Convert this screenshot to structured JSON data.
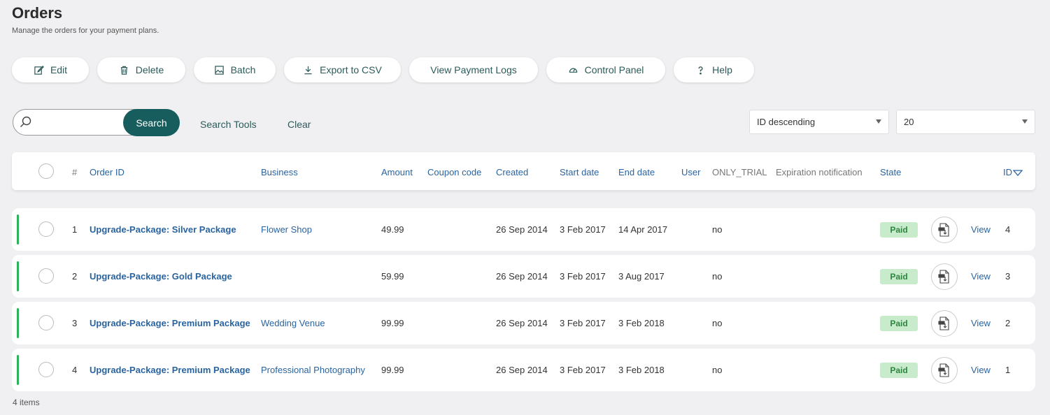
{
  "page": {
    "title": "Orders",
    "subtitle": "Manage the orders for your payment plans."
  },
  "toolbar": {
    "edit": "Edit",
    "delete": "Delete",
    "batch": "Batch",
    "export": "Export to CSV",
    "logs": "View Payment Logs",
    "control": "Control Panel",
    "help": "Help"
  },
  "search": {
    "placeholder": "",
    "button": "Search",
    "tools": "Search Tools",
    "clear": "Clear"
  },
  "sort": {
    "selected": "ID descending",
    "per_page": "20"
  },
  "table": {
    "headers": {
      "num": "#",
      "order_id": "Order ID",
      "business": "Business",
      "amount": "Amount",
      "coupon": "Coupon code",
      "created": "Created",
      "start": "Start date",
      "end": "End date",
      "user": "User",
      "trial": "ONLY_TRIAL",
      "expiration": "Expiration notification",
      "state": "State",
      "id": "ID"
    },
    "rows": [
      {
        "num": "1",
        "order_id": "Upgrade-Package: Silver Package",
        "business": "Flower Shop",
        "amount": "49.99",
        "coupon": "",
        "created": "26 Sep 2014",
        "start": "3 Feb 2017",
        "end": "14 Apr 2017",
        "user": "",
        "trial": "no",
        "state": "Paid",
        "view": "View",
        "id": "4"
      },
      {
        "num": "2",
        "order_id": "Upgrade-Package: Gold Package",
        "business": "",
        "amount": "59.99",
        "coupon": "",
        "created": "26 Sep 2014",
        "start": "3 Feb 2017",
        "end": "3 Aug 2017",
        "user": "",
        "trial": "no",
        "state": "Paid",
        "view": "View",
        "id": "3"
      },
      {
        "num": "3",
        "order_id": "Upgrade-Package: Premium Package",
        "business": "Wedding Venue",
        "amount": "99.99",
        "coupon": "",
        "created": "26 Sep 2014",
        "start": "3 Feb 2017",
        "end": "3 Feb 2018",
        "user": "",
        "trial": "no",
        "state": "Paid",
        "view": "View",
        "id": "2"
      },
      {
        "num": "4",
        "order_id": "Upgrade-Package: Premium Package",
        "business": "Professional Photography",
        "amount": "99.99",
        "coupon": "",
        "created": "26 Sep 2014",
        "start": "3 Feb 2017",
        "end": "3 Feb 2018",
        "user": "",
        "trial": "no",
        "state": "Paid",
        "view": "View",
        "id": "1"
      }
    ]
  },
  "footer": {
    "count": "4 items"
  },
  "colors": {
    "accent": "#175d5d",
    "link": "#2a64a0",
    "paid_bg": "#c7ebcb",
    "paid_text": "#2e8540",
    "row_accent": "#2fb05a"
  }
}
